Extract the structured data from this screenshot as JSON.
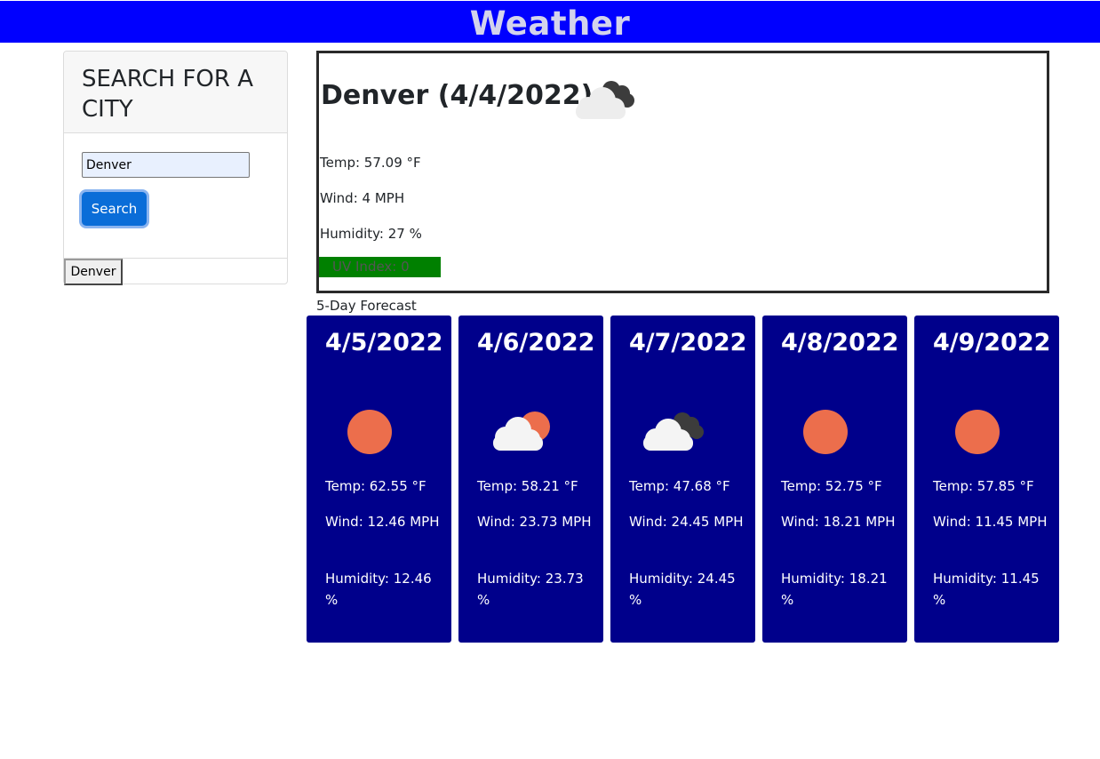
{
  "header": {
    "title": "Weather"
  },
  "search": {
    "heading": "SEARCH FOR A CITY",
    "input_value": "Denver",
    "button_label": "Search",
    "history": [
      "Denver"
    ]
  },
  "current": {
    "title": "Denver (4/4/2022)",
    "icon": "cloudy-icon",
    "temp": "Temp: 57.09 °F",
    "wind": "Wind: 4 MPH",
    "humidity": "Humidity: 27 %",
    "uv": "UV Index: 0",
    "uv_color": "#008000"
  },
  "forecast": {
    "label": "5-Day Forecast",
    "card_color": "#00008b",
    "days": [
      {
        "date": "4/5/2022",
        "icon": "sun-icon",
        "temp": "Temp: 62.55 °F",
        "wind": "Wind: 12.46 MPH",
        "humidity": "Humidity: 12.46 %"
      },
      {
        "date": "4/6/2022",
        "icon": "partly-cloudy-icon",
        "temp": "Temp: 58.21 °F",
        "wind": "Wind: 23.73 MPH",
        "humidity": "Humidity: 23.73 %"
      },
      {
        "date": "4/7/2022",
        "icon": "cloudy-icon",
        "temp": "Temp: 47.68 °F",
        "wind": "Wind: 24.45 MPH",
        "humidity": "Humidity: 24.45 %"
      },
      {
        "date": "4/8/2022",
        "icon": "sun-icon",
        "temp": "Temp: 52.75 °F",
        "wind": "Wind: 18.21 MPH",
        "humidity": "Humidity: 18.21 %"
      },
      {
        "date": "4/9/2022",
        "icon": "sun-icon",
        "temp": "Temp: 57.85 °F",
        "wind": "Wind: 11.45 MPH",
        "humidity": "Humidity: 11.45 %"
      }
    ]
  }
}
